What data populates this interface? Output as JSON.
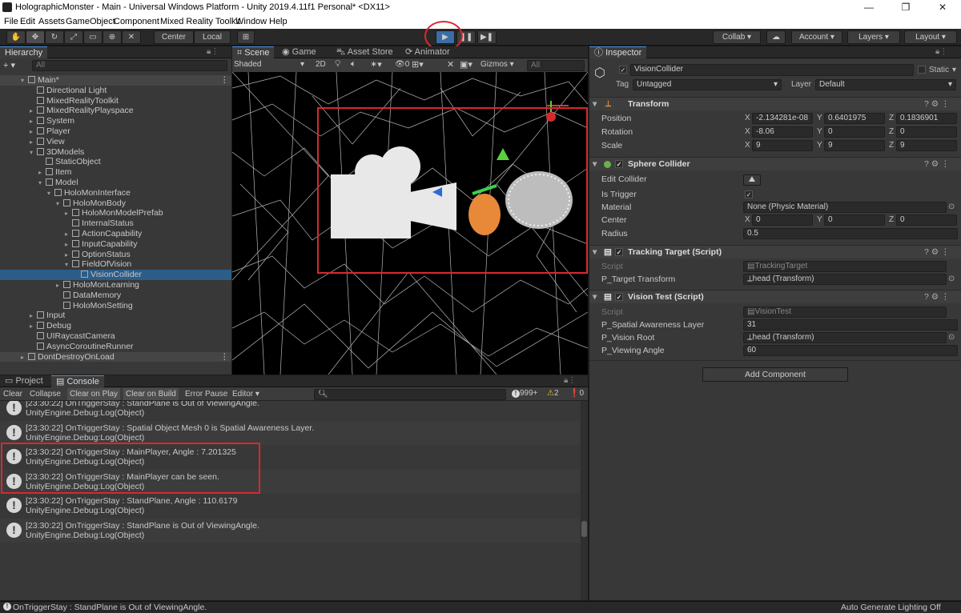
{
  "window": {
    "title": "HolographicMonster - Main - Universal Windows Platform - Unity 2019.4.11f1 Personal* <DX11>",
    "controls": [
      "—",
      "❐",
      "✕"
    ]
  },
  "menu": [
    "File",
    "Edit",
    "Assets",
    "GameObject",
    "Component",
    "Mixed Reality Toolkit",
    "Window",
    "Help"
  ],
  "toolbar": {
    "center_label": "Center",
    "local_label": "Local",
    "collab_label": "Collab ▾",
    "account_label": "Account",
    "layers_label": "Layers",
    "layout_label": "Layout"
  },
  "hierarchy": {
    "tab_label": "Hierarchy",
    "search_placeholder": "All",
    "items": [
      {
        "label": "Main*"
      },
      {
        "label": "Directional Light"
      },
      {
        "label": "MixedRealityToolkit"
      },
      {
        "label": "MixedRealityPlayspace"
      },
      {
        "label": "System"
      },
      {
        "label": "Player"
      },
      {
        "label": "View"
      },
      {
        "label": "3DModels"
      },
      {
        "label": "StaticObject"
      },
      {
        "label": "Item"
      },
      {
        "label": "Model"
      },
      {
        "label": "HoloMonInterface"
      },
      {
        "label": "HoloMonBody"
      },
      {
        "label": "HoloMonModelPrefab"
      },
      {
        "label": "InternalStatus"
      },
      {
        "label": "ActionCapability"
      },
      {
        "label": "InputCapability"
      },
      {
        "label": "OptionStatus"
      },
      {
        "label": "FieldOfVision"
      },
      {
        "label": "VisionCollider"
      },
      {
        "label": "HoloMonLearning"
      },
      {
        "label": "DataMemory"
      },
      {
        "label": "HoloMonSetting"
      },
      {
        "label": "Input"
      },
      {
        "label": "Debug"
      },
      {
        "label": "UIRaycastCamera"
      },
      {
        "label": "AsyncCoroutineRunner"
      },
      {
        "label": "DontDestroyOnLoad"
      }
    ]
  },
  "scene": {
    "tabs": [
      "Scene",
      "Game",
      "Asset Store",
      "Animator"
    ],
    "shading_mode": "Shaded",
    "mode_2d": "2D",
    "fx_count": "0",
    "gizmos_label": "Gizmos",
    "search_placeholder": "All"
  },
  "bottom": {
    "tabs": [
      "Project",
      "Console"
    ],
    "buttons": [
      "Clear",
      "Collapse",
      "Clear on Play",
      "Clear on Build",
      "Error Pause",
      "Editor ▾"
    ],
    "log_count": "999+",
    "warn_count": "2",
    "error_count": "0",
    "rows": [
      {
        "line1": "[23:30:22] OnTriggerStay : StandPlane is Out of ViewingAngle.",
        "line2": "UnityEngine.Debug:Log(Object)"
      },
      {
        "line1": "[23:30:22] OnTriggerStay : Spatial Object Mesh 0 is Spatial Awareness Layer.",
        "line2": "UnityEngine.Debug:Log(Object)"
      },
      {
        "line1": "[23:30:22] OnTriggerStay : MainPlayer, Angle : 7.201325",
        "line2": "UnityEngine.Debug:Log(Object)"
      },
      {
        "line1": "[23:30:22] OnTriggerStay : MainPlayer can be seen.",
        "line2": "UnityEngine.Debug:Log(Object)"
      },
      {
        "line1": "[23:30:22] OnTriggerStay : StandPlane, Angle : 110.6179",
        "line2": "UnityEngine.Debug:Log(Object)"
      },
      {
        "line1": "[23:30:22] OnTriggerStay : StandPlane is Out of ViewingAngle.",
        "line2": "UnityEngine.Debug:Log(Object)"
      }
    ]
  },
  "status_bar": {
    "message": "OnTriggerStay : StandPlane is Out of ViewingAngle.",
    "right": "Auto Generate Lighting Off"
  },
  "inspector": {
    "tab_label": "Inspector",
    "object_name": "VisionCollider",
    "static_label": "Static",
    "tag_label": "Tag",
    "tag_value": "Untagged",
    "layer_label": "Layer",
    "layer_value": "Default",
    "transform": {
      "title": "Transform",
      "position_label": "Position",
      "rotation_label": "Rotation",
      "scale_label": "Scale",
      "position": [
        "-2.134281e-08",
        "0.6401975",
        "0.1836901"
      ],
      "rotation": [
        "-8.06",
        "0",
        "0"
      ],
      "scale": [
        "9",
        "9",
        "9"
      ],
      "axes": [
        "X",
        "Y",
        "Z"
      ]
    },
    "sphere_collider": {
      "title": "Sphere Collider",
      "edit_collider_label": "Edit Collider",
      "is_trigger_label": "Is Trigger",
      "material_label": "Material",
      "material_value": "None (Physic Material)",
      "center_label": "Center",
      "center": [
        "0",
        "0",
        "0"
      ],
      "radius_label": "Radius",
      "radius_value": "0.5"
    },
    "tracking_target": {
      "title": "Tracking Target (Script)",
      "script_label": "Script",
      "script_value": "TrackingTarget",
      "target_label": "P_Target Transform",
      "target_value": "head (Transform)"
    },
    "vision_test": {
      "title": "Vision Test (Script)",
      "script_label": "Script",
      "script_value": "VisionTest",
      "layer_label": "P_Spatial Awareness Layer",
      "layer_value": "31",
      "root_label": "P_Vision Root",
      "root_value": "head (Transform)",
      "angle_label": "P_Viewing Angle",
      "angle_value": "60"
    },
    "add_component_label": "Add Component"
  },
  "colors": {
    "highlight": "#d9282f",
    "selection": "#2c5d87",
    "panel": "#383838"
  }
}
